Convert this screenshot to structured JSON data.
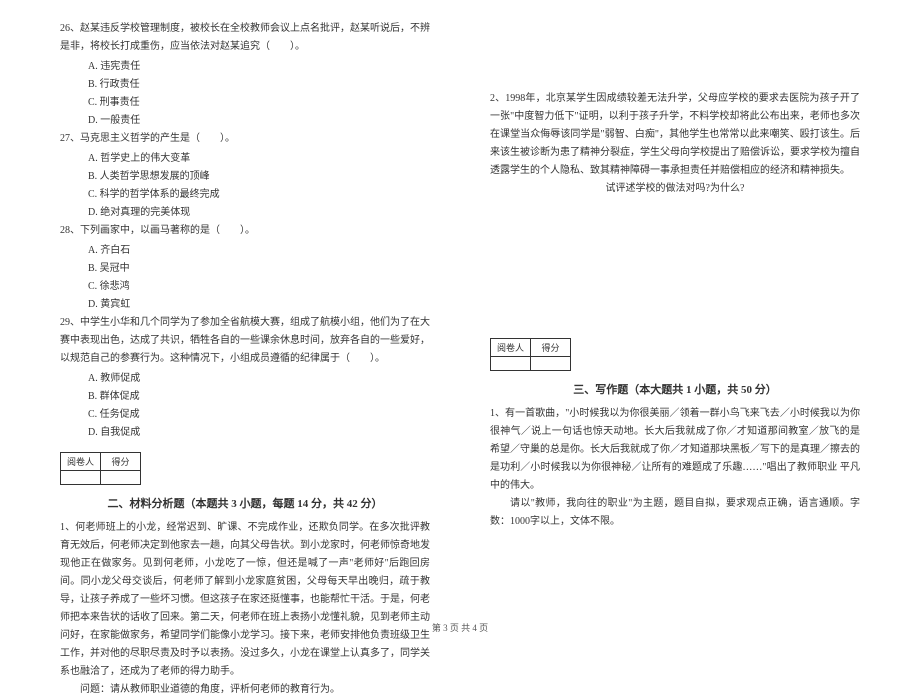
{
  "left": {
    "q26": {
      "stem": "26、赵某违反学校管理制度，被校长在全校教师会议上点名批评，赵某听说后，不辨是非，将校长打成重伤，应当依法对赵某追究（　　）。",
      "opts": [
        "A. 违宪责任",
        "B. 行政责任",
        "C. 刑事责任",
        "D. 一般责任"
      ]
    },
    "q27": {
      "stem": "27、马克思主义哲学的产生是（　　）。",
      "opts": [
        "A. 哲学史上的伟大变革",
        "B. 人类哲学思想发展的顶峰",
        "C. 科学的哲学体系的最终完成",
        "D. 绝对真理的完美体现"
      ]
    },
    "q28": {
      "stem": "28、下列画家中，以画马著称的是（　　）。",
      "opts": [
        "A. 齐白石",
        "B. 吴冠中",
        "C. 徐悲鸿",
        "D. 黄宾虹"
      ]
    },
    "q29": {
      "stem": "29、中学生小华和几个同学为了参加全省航模大赛，组成了航模小组，他们为了在大赛中表现出色，达成了共识，牺牲各自的一些课余休息时间，放弃各自的一些爱好，以规范自己的参赛行为。这种情况下，小组成员遵循的纪律属于（　　）。",
      "opts": [
        "A. 教师促成",
        "B. 群体促成",
        "C. 任务促成",
        "D. 自我促成"
      ]
    },
    "scorebox": {
      "c1": "阅卷人",
      "c2": "得分"
    },
    "section2_title": "二、材料分析题（本题共 3 小题，每题 14 分，共 42 分）",
    "analysis1": {
      "p1": "1、何老师班上的小龙，经常迟到、旷课、不完成作业，还欺负同学。在多次批评教育无效后，何老师决定到他家去一趟，向其父母告状。到小龙家时，何老师惊奇地发现他正在做家务。见到何老师，小龙吃了一惊，但还是喊了一声\"老师好\"后跑回房间。同小龙父母交谈后，何老师了解到小龙家庭贫困，父母每天早出晚归，疏于教导，让孩子养成了一些坏习惯。但这孩子在家还挺懂事，也能帮忙干活。于是，何老师把本来告状的话收了回来。第二天，何老师在班上表扬小龙懂礼貌，见到老师主动问好，在家能做家务，希望同学们能像小龙学习。接下来，老师安排他负责班级卫生工作，并对他的尽职尽责及时予以表扬。没过多久，小龙在课堂上认真多了，同学关系也融洽了，还成为了老师的得力助手。",
      "p2": "问题：请从教师职业道德的角度，评析何老师的教育行为。"
    }
  },
  "right": {
    "analysis2": {
      "p1": "2、1998年，北京某学生因成绩较差无法升学，父母应学校的要求去医院为孩子开了一张\"中度智力低下\"证明，以利于孩子升学，不料学校却将此公布出来，老师也多次在课堂当众侮辱该同学是\"弱智、白痴\"，其他学生也常常以此来嘲笑、殴打该生。后来该生被诊断为患了精神分裂症，学生父母向学校提出了赔偿诉讼，要求学校为擅自透露学生的个人隐私、致其精神障碍一事承担责任并赔偿相应的经济和精神损失。",
      "p2": "试评述学校的做法对吗?为什么?"
    },
    "scorebox": {
      "c1": "阅卷人",
      "c2": "得分"
    },
    "section3_title": "三、写作题（本大题共 1 小题，共 50 分）",
    "essay": {
      "p1": "1、有一首歌曲，\"小时候我以为你很美丽／领着一群小鸟飞来飞去／小时候我以为你很神气／说上一句话也惊天动地。长大后我就成了你／才知道那间教室／放飞的是 希望／守巢的总是你。长大后我就成了你／才知道那块黑板／写下的是真理／擦去的是功利／小时候我以为你很神秘／让所有的难题成了乐趣……\"唱出了教师职业 平凡中的伟大。",
      "p2": "请以\"教师，我向往的职业\"为主题，题目自拟，要求观点正确，语言通顺。字数：1000字以上，文体不限。"
    }
  },
  "footer": "第 3 页   共 4 页"
}
